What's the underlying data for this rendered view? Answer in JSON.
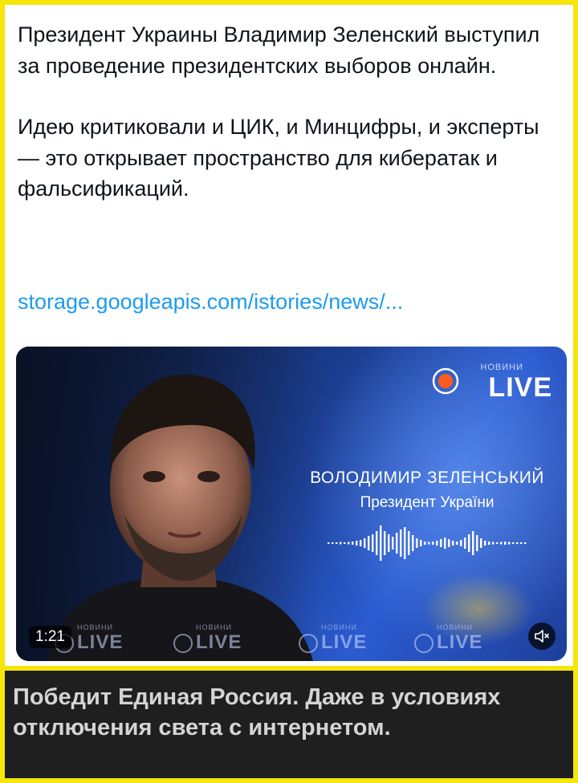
{
  "post": {
    "paragraph1": "Президент Украины Владимир Зеленский выступил за проведение президентских выборов онлайн.",
    "paragraph2": "Идею критиковали и ЦИК, и Минцифры, и эксперты — это открывает пространство для кибератак и фальсификаций.",
    "link_text": "storage.googleapis.com/istories/news/..."
  },
  "video": {
    "brand_small": "НОВИНИ",
    "brand_live": "LIVE",
    "speaker_name": "ВОЛОДИМИР ЗЕЛЕНСЬКИЙ",
    "speaker_role": "Президент України",
    "watermark_small": "НОВИНИ",
    "watermark_big": "LIVE",
    "timestamp": "1:21",
    "mute_icon": "speaker-muted-icon"
  },
  "caption": {
    "text": "Победит Единая Россия. Даже в условиях отключения света с интернетом."
  },
  "colors": {
    "frame_border": "#f6e60a",
    "link": "#1d9bf0",
    "caption_bg": "#1f1f1f",
    "caption_text": "#d4d4d4",
    "brand_accent": "#ff5a1f"
  }
}
